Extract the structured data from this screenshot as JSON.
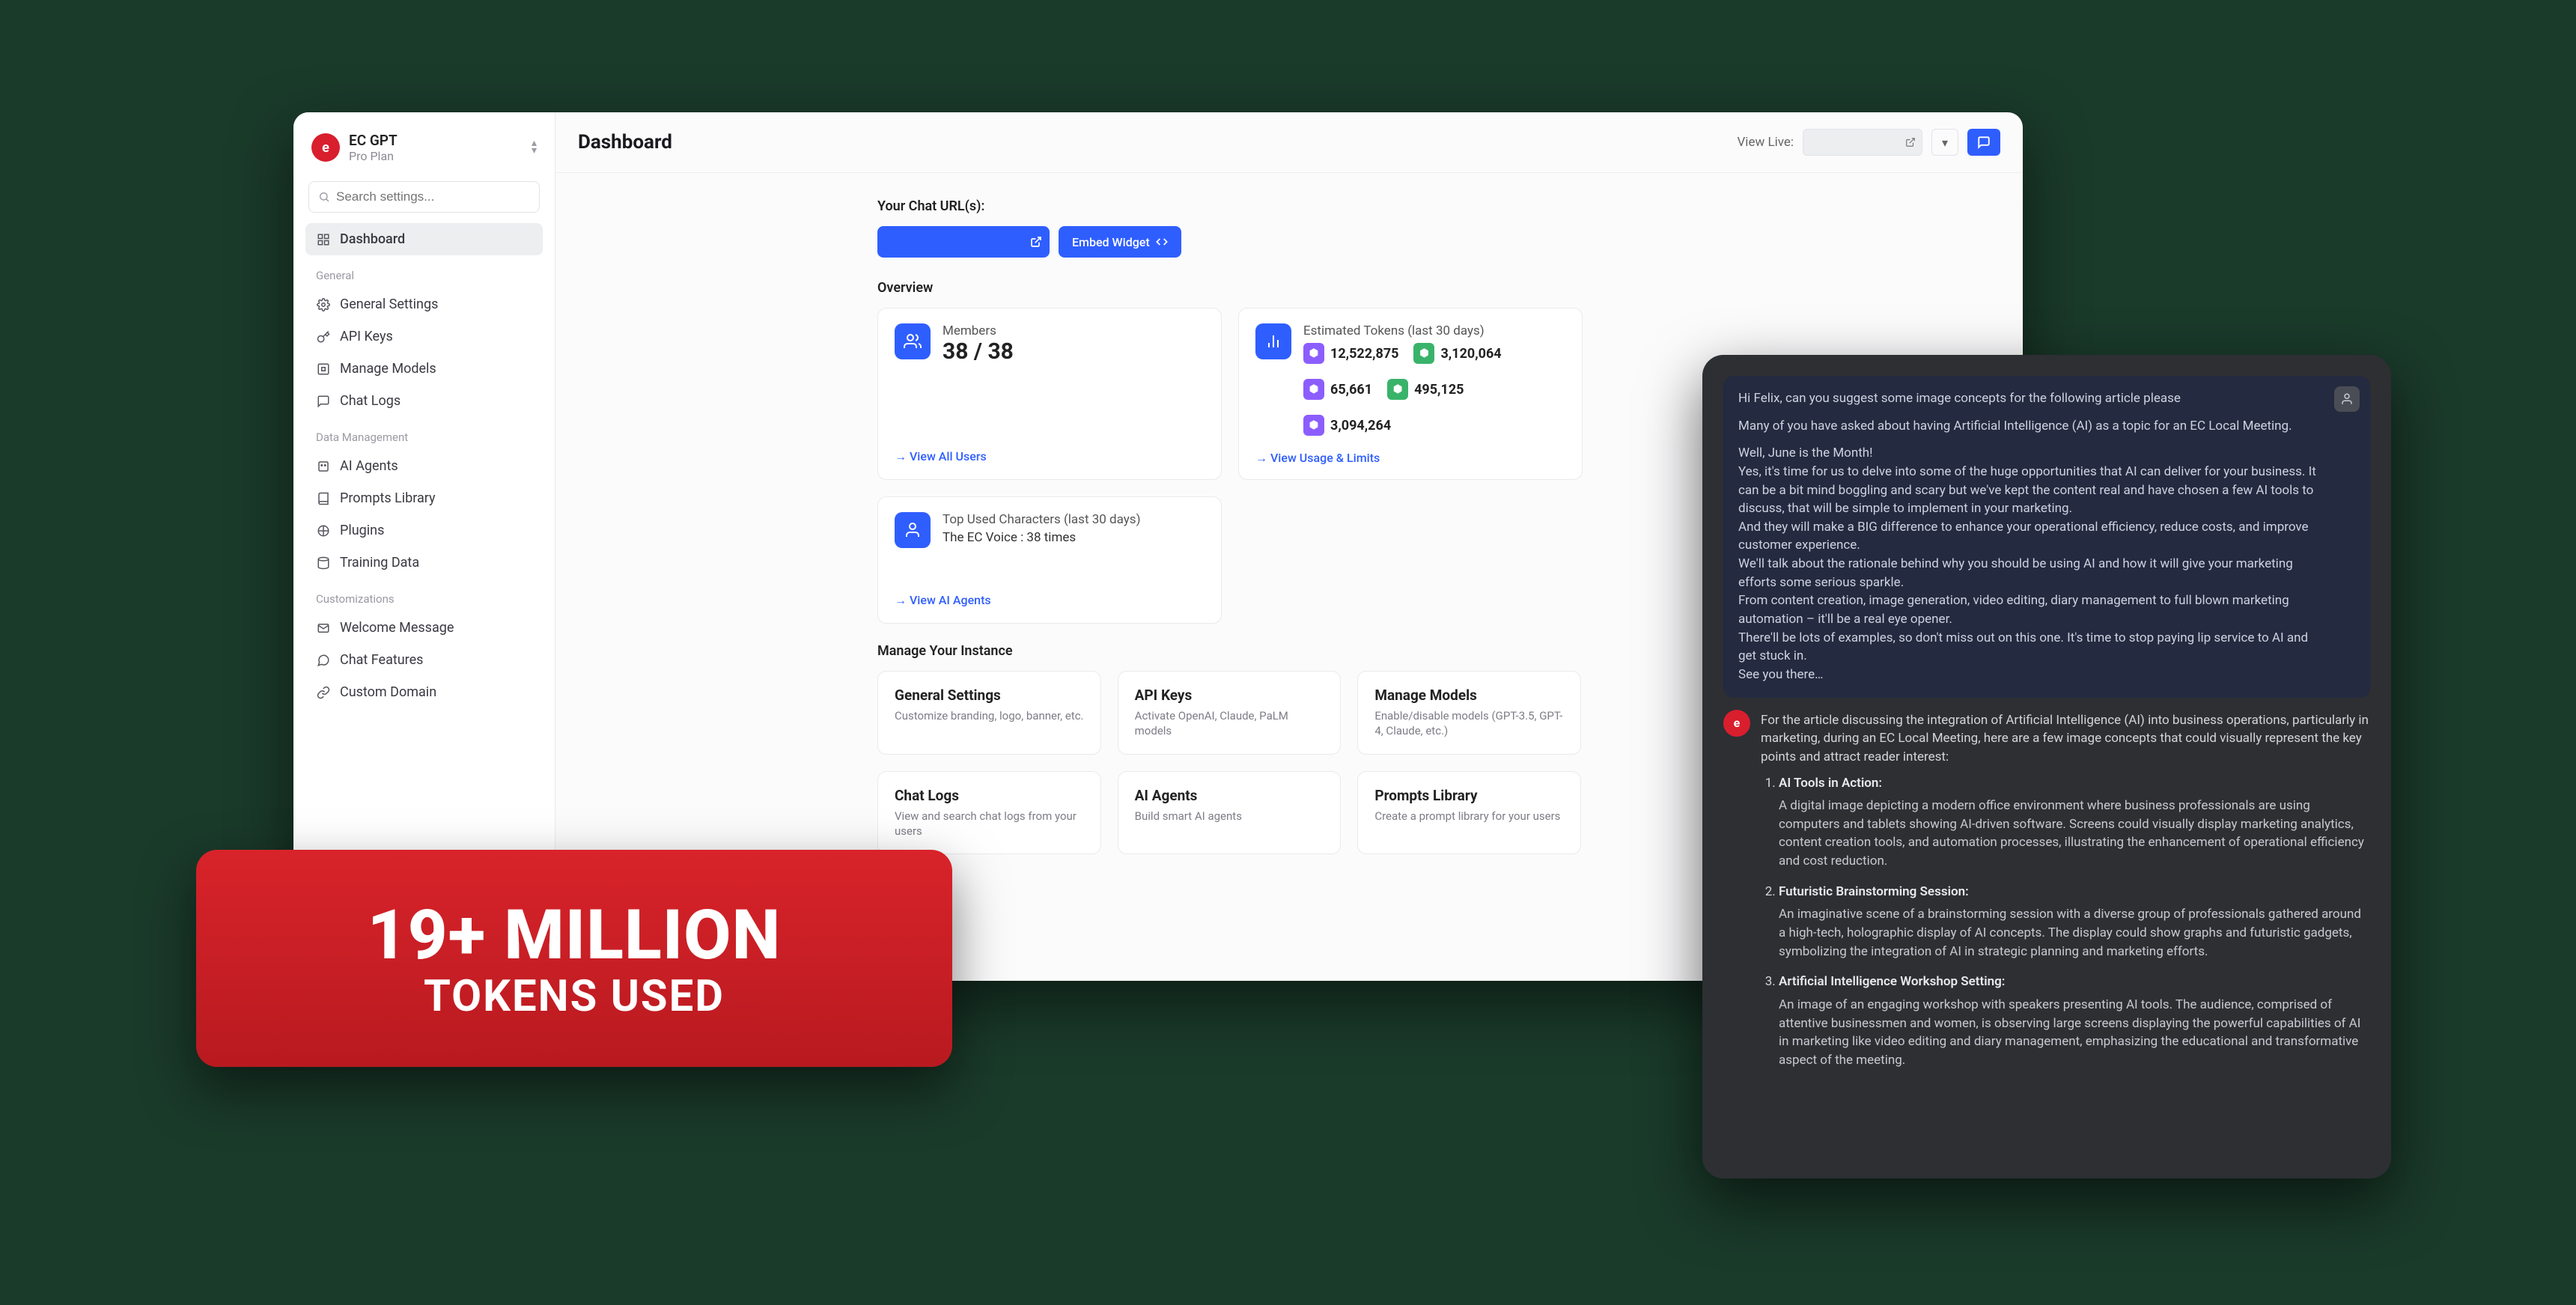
{
  "brand": {
    "name": "EC GPT",
    "plan": "Pro Plan",
    "logo_letter": "e"
  },
  "search": {
    "placeholder": "Search settings..."
  },
  "nav": {
    "dashboard": "Dashboard",
    "sections": {
      "general": "General",
      "data": "Data Management",
      "custom": "Customizations"
    },
    "items": {
      "general_settings": "General Settings",
      "api_keys": "API Keys",
      "manage_models": "Manage Models",
      "chat_logs": "Chat Logs",
      "ai_agents": "AI Agents",
      "prompts_library": "Prompts Library",
      "plugins": "Plugins",
      "training_data": "Training Data",
      "welcome_message": "Welcome Message",
      "chat_features": "Chat Features",
      "custom_domain": "Custom Domain"
    }
  },
  "topbar": {
    "title": "Dashboard",
    "view_live": "View Live:"
  },
  "chat_url": {
    "label": "Your Chat URL(s):",
    "embed": "Embed Widget"
  },
  "overview": {
    "label": "Overview",
    "members": {
      "title": "Members",
      "value": "38 / 38",
      "link": "→ View All Users"
    },
    "tokens": {
      "title": "Estimated Tokens (last 30 days)",
      "values": [
        "12,522,875",
        "3,120,064",
        "65,661",
        "495,125",
        "3,094,264"
      ],
      "link": "→ View Usage & Limits"
    },
    "characters": {
      "title": "Top Used Characters (last 30 days)",
      "line": "The EC Voice : 38 times",
      "link": "→ View AI Agents"
    }
  },
  "manage": {
    "label": "Manage Your Instance",
    "cards": [
      {
        "title": "General Settings",
        "desc": "Customize branding, logo, banner, etc."
      },
      {
        "title": "API Keys",
        "desc": "Activate OpenAI, Claude, PaLM models"
      },
      {
        "title": "Manage Models",
        "desc": "Enable/disable models (GPT-3.5, GPT-4, Claude, etc.)"
      },
      {
        "title": "Chat Logs",
        "desc": "View and search chat logs from your users"
      },
      {
        "title": "AI Agents",
        "desc": "Build smart AI agents"
      },
      {
        "title": "Prompts Library",
        "desc": "Create a prompt library for your users"
      }
    ]
  },
  "badge": {
    "line1": "19+ MILLION",
    "line2": "TOKENS USED"
  },
  "chat": {
    "user_lead": "Hi Felix, can you suggest some image concepts for the following article please",
    "user_body": [
      "Many of you have asked about having Artificial Intelligence (AI) as a topic for an EC Local Meeting.",
      "Well, June is the Month!",
      "Yes, it's time for us to delve into some of the huge opportunities that AI can deliver for your business. It can be a bit mind boggling and scary but we've kept the content real and have chosen a few AI tools to discuss, that will be simple to implement in your marketing.",
      "And they will make a BIG difference to enhance your operational efficiency, reduce costs, and improve customer experience.",
      "We'll talk about the rationale behind why you should be using AI and how it will give your marketing efforts some serious sparkle.",
      "From content creation, image generation, video editing, diary management to full blown marketing automation – it'll be a real eye opener.",
      "There'll be lots of examples, so don't miss out on this one. It's time to stop paying lip service to AI and get stuck in.",
      "See you there…"
    ],
    "assistant_intro": "For the article discussing the integration of Artificial Intelligence (AI) into business operations, particularly in marketing, during an EC Local Meeting, here are a few image concepts that could visually represent the key points and attract reader interest:",
    "assistant_items": [
      {
        "title": "AI Tools in Action:",
        "body": "A digital image depicting a modern office environment where business professionals are using computers and tablets showing AI-driven software. Screens could visually display marketing analytics, content creation tools, and automation processes, illustrating the enhancement of operational efficiency and cost reduction."
      },
      {
        "title": "Futuristic Brainstorming Session:",
        "body": "An imaginative scene of a brainstorming session with a diverse group of professionals gathered around a high-tech, holographic display of AI concepts. The display could show graphs and futuristic gadgets, symbolizing the integration of AI in strategic planning and marketing efforts."
      },
      {
        "title": "Artificial Intelligence Workshop Setting:",
        "body": "An image of an engaging workshop with speakers presenting AI tools. The audience, comprised of attentive businessmen and women, is observing large screens displaying the powerful capabilities of AI in marketing like video editing and diary management, emphasizing the educational and transformative aspect of the meeting."
      }
    ]
  }
}
